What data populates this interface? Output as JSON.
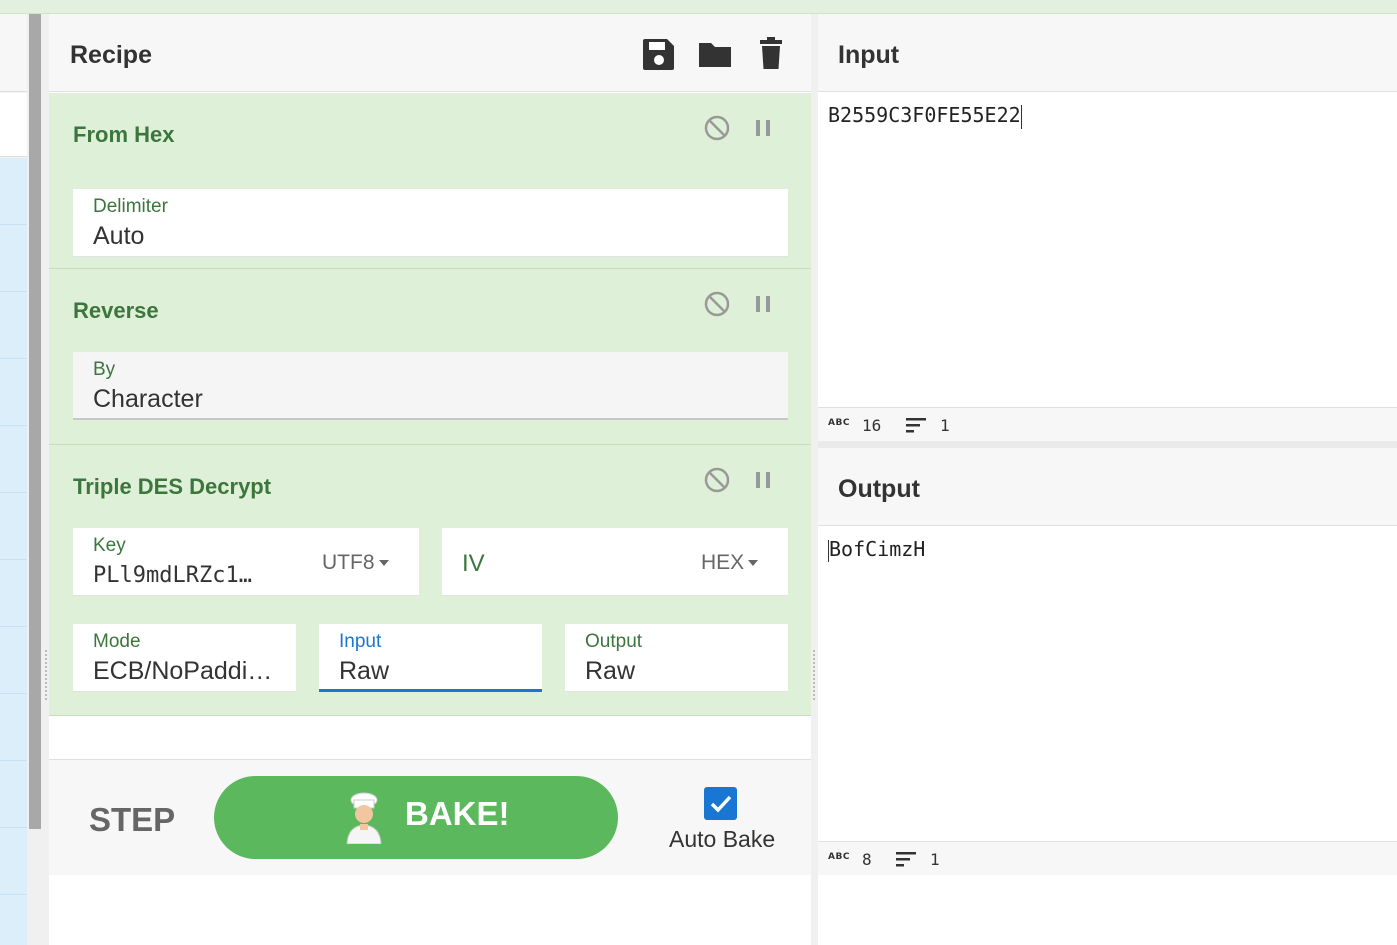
{
  "recipe": {
    "title": "Recipe",
    "header_icons": [
      "save-icon",
      "folder-icon",
      "trash-icon"
    ],
    "operations": [
      {
        "title": "From Hex",
        "fields": [
          {
            "label": "Delimiter",
            "value": "Auto"
          }
        ]
      },
      {
        "title": "Reverse",
        "fields": [
          {
            "label": "By",
            "value": "Character"
          }
        ]
      },
      {
        "title": "Triple DES Decrypt",
        "key": {
          "label": "Key",
          "value": "PLl9mdLRZc1…",
          "encoding": "UTF8"
        },
        "iv": {
          "placeholder": "IV",
          "encoding": "HEX"
        },
        "mode": {
          "label": "Mode",
          "value": "ECB/NoPaddi…"
        },
        "input": {
          "label": "Input",
          "value": "Raw"
        },
        "output": {
          "label": "Output",
          "value": "Raw"
        }
      }
    ]
  },
  "controls": {
    "step": "STEP",
    "bake": "BAKE!",
    "auto_bake": "Auto Bake",
    "auto_bake_checked": true
  },
  "input": {
    "title": "Input",
    "text": "B2559C3F0FE55E22",
    "abc_label": "ABC",
    "length": "16",
    "lines": "1"
  },
  "output": {
    "title": "Output",
    "text": "BofCimzH",
    "abc_label": "ABC",
    "length": "8",
    "lines": "1"
  },
  "colors": {
    "accent_green": "#3c763d",
    "op_background": "#dff0d8",
    "bake_button": "#5cb85c",
    "active_blue": "#1976d2"
  }
}
